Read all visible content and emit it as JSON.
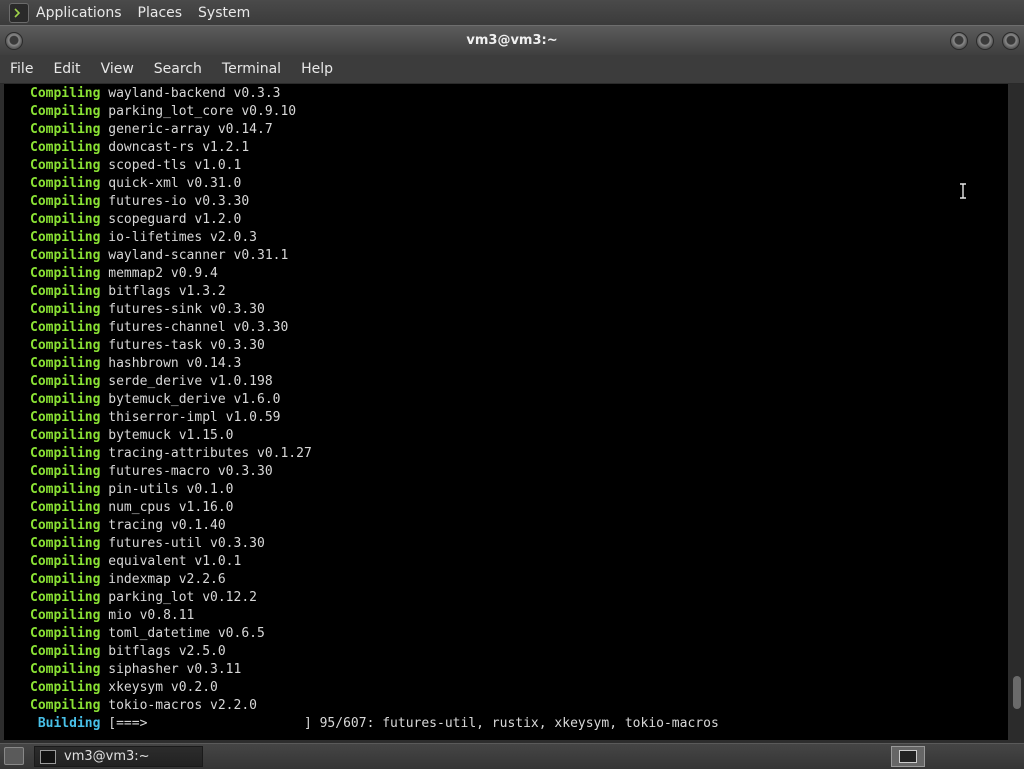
{
  "top_panel": {
    "menus": [
      "Applications",
      "Places",
      "System"
    ]
  },
  "window": {
    "title": "vm3@vm3:~",
    "menu": [
      "File",
      "Edit",
      "View",
      "Search",
      "Terminal",
      "Help"
    ]
  },
  "terminal": {
    "lines": [
      {
        "keyword": "Compiling",
        "text": "wayland-backend v0.3.3"
      },
      {
        "keyword": "Compiling",
        "text": "parking_lot_core v0.9.10"
      },
      {
        "keyword": "Compiling",
        "text": "generic-array v0.14.7"
      },
      {
        "keyword": "Compiling",
        "text": "downcast-rs v1.2.1"
      },
      {
        "keyword": "Compiling",
        "text": "scoped-tls v1.0.1"
      },
      {
        "keyword": "Compiling",
        "text": "quick-xml v0.31.0"
      },
      {
        "keyword": "Compiling",
        "text": "futures-io v0.3.30"
      },
      {
        "keyword": "Compiling",
        "text": "scopeguard v1.2.0"
      },
      {
        "keyword": "Compiling",
        "text": "io-lifetimes v2.0.3"
      },
      {
        "keyword": "Compiling",
        "text": "wayland-scanner v0.31.1"
      },
      {
        "keyword": "Compiling",
        "text": "memmap2 v0.9.4"
      },
      {
        "keyword": "Compiling",
        "text": "bitflags v1.3.2"
      },
      {
        "keyword": "Compiling",
        "text": "futures-sink v0.3.30"
      },
      {
        "keyword": "Compiling",
        "text": "futures-channel v0.3.30"
      },
      {
        "keyword": "Compiling",
        "text": "futures-task v0.3.30"
      },
      {
        "keyword": "Compiling",
        "text": "hashbrown v0.14.3"
      },
      {
        "keyword": "Compiling",
        "text": "serde_derive v1.0.198"
      },
      {
        "keyword": "Compiling",
        "text": "bytemuck_derive v1.6.0"
      },
      {
        "keyword": "Compiling",
        "text": "thiserror-impl v1.0.59"
      },
      {
        "keyword": "Compiling",
        "text": "bytemuck v1.15.0"
      },
      {
        "keyword": "Compiling",
        "text": "tracing-attributes v0.1.27"
      },
      {
        "keyword": "Compiling",
        "text": "futures-macro v0.3.30"
      },
      {
        "keyword": "Compiling",
        "text": "pin-utils v0.1.0"
      },
      {
        "keyword": "Compiling",
        "text": "num_cpus v1.16.0"
      },
      {
        "keyword": "Compiling",
        "text": "tracing v0.1.40"
      },
      {
        "keyword": "Compiling",
        "text": "futures-util v0.3.30"
      },
      {
        "keyword": "Compiling",
        "text": "equivalent v1.0.1"
      },
      {
        "keyword": "Compiling",
        "text": "indexmap v2.2.6"
      },
      {
        "keyword": "Compiling",
        "text": "parking_lot v0.12.2"
      },
      {
        "keyword": "Compiling",
        "text": "mio v0.8.11"
      },
      {
        "keyword": "Compiling",
        "text": "toml_datetime v0.6.5"
      },
      {
        "keyword": "Compiling",
        "text": "bitflags v2.5.0"
      },
      {
        "keyword": "Compiling",
        "text": "siphasher v0.3.11"
      },
      {
        "keyword": "Compiling",
        "text": "xkeysym v0.2.0"
      },
      {
        "keyword": "Compiling",
        "text": "tokio-macros v2.2.0"
      }
    ],
    "building": {
      "keyword": "Building",
      "progress_bar": "[===>                    ]",
      "status": "95/607: futures-util, rustix, xkeysym, tokio-macros"
    },
    "scroll_position": 0.95,
    "scroll_visible_fraction": 0.05
  },
  "taskbar": {
    "window_label": "vm3@vm3:~"
  },
  "colors": {
    "compiling": "#8ae234",
    "building": "#48c0e8",
    "terminal_bg": "#000000",
    "terminal_fg": "#d8d8d8"
  },
  "icons": [
    "terminal-app-icon",
    "window-control-icon",
    "ibeam-cursor-icon",
    "show-desktop-icon",
    "terminal-window-icon",
    "workspace-icon"
  ]
}
